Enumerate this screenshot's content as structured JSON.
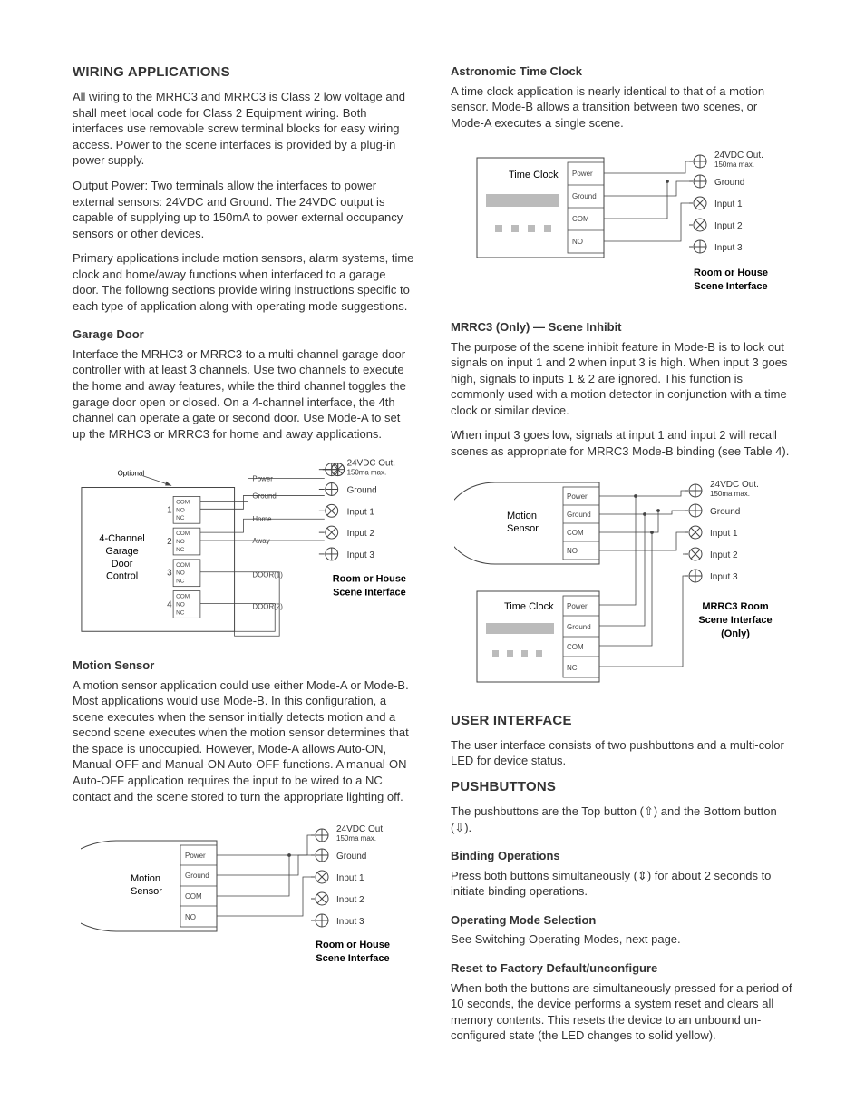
{
  "left": {
    "h_wiring": "WIRING APPLICATIONS",
    "p_wiring1": "All wiring to the MRHC3 and MRRC3 is Class 2 low voltage and shall meet local code for Class 2 Equipment wiring. Both interfaces use removable screw terminal blocks for easy wiring access. Power to the scene interfaces is provided by a plug-in power supply.",
    "p_wiring2": "Output Power: Two terminals allow the interfaces to power external sensors: 24VDC and Ground. The 24VDC output is capable of supplying up to 150mA to power external occupancy sensors or other devices.",
    "p_wiring3": "Primary applications include motion sensors, alarm systems, time clock and home/away functions when interfaced to a garage door. The followng sections provide wiring instructions specific to each type of application along with operating mode suggestions.",
    "h_garage": "Garage Door",
    "p_garage": "Interface the MRHC3 or MRRC3 to a multi-channel garage door controller with at least 3 channels. Use two channels to execute the home and away features, while the third channel toggles the garage door open or closed. On a 4-channel interface, the 4th channel can operate a gate or second door. Use Mode-A to set up the MRHC3 or MRRC3 for home and away applications.",
    "h_motion": "Motion Sensor",
    "p_motion": "A motion sensor application could use either Mode-A or Mode-B. Most applications would use Mode-B. In this configuration, a scene executes when the sensor initially detects motion and a second scene executes when the motion sensor determines that the space is unoccupied. However, Mode-A allows Auto-ON, Manual-OFF and Manual-ON Auto-OFF functions. A manual-ON Auto-OFF application requires the input to be wired to a NC contact and the scene stored to turn the appropriate lighting off."
  },
  "right": {
    "h_astro": "Astronomic Time Clock",
    "p_astro": "A time clock application is nearly identical to that of a motion sensor. Mode-B allows a transition between two scenes, or Mode-A executes a single scene.",
    "h_inhibit": "MRRC3 (Only) — Scene Inhibit",
    "p_inhibit1": "The purpose of the scene inhibit feature in Mode-B is to lock out signals on input 1 and 2 when input 3 is high. When input 3 goes high, signals to inputs 1 & 2 are ignored. This function is commonly used with a motion detector in conjunction with a time clock or similar device.",
    "p_inhibit2": "When input 3 goes low, signals at input 1 and input 2 will recall scenes as appropriate for MRRC3 Mode-B binding (see Table 4).",
    "h_ui": "USER INTERFACE",
    "p_ui": "The user interface consists of two pushbuttons and a multi-color LED for device status.",
    "h_push": "PUSHBUTTONS",
    "p_push": "The pushbuttons are the Top button (⇧) and the Bottom button (⇩).",
    "h_bind": "Binding Operations",
    "p_bind": "Press both buttons simultaneously (⇕) for about 2 seconds to initiate binding operations.",
    "h_mode": "Operating Mode Selection",
    "p_mode": "See Switching Operating Modes, next page.",
    "h_reset": "Reset to Factory Default/unconfigure",
    "p_reset": "When both the buttons are simultaneously pressed for a period of 10 seconds, the device performs a system reset and clears all memory contents. This resets the device to an unbound un-configured state (the LED changes to solid yellow)."
  },
  "labels": {
    "vdc": "24VDC Out.",
    "ma": "150ma max.",
    "ground": "Ground",
    "in1": "Input 1",
    "in2": "Input 2",
    "in3": "Input 3",
    "power": "Power",
    "com": "COM",
    "no": "NO",
    "nc": "NC",
    "home": "Home",
    "away": "Away",
    "door1": "DOOR(1)",
    "door2": "DOOR(2)",
    "optional": "Optional",
    "motion": "Motion",
    "sensor": "Sensor",
    "timeclock": "Time Clock",
    "four_ch_1": "4-Channel",
    "four_ch_2": "Garage",
    "four_ch_3": "Door",
    "four_ch_4": "Control",
    "rh1": "Room or House",
    "rh2": "Scene Interface",
    "mrrc1": "MRRC3 Room",
    "mrrc2": "Scene Interface",
    "mrrc3": "(Only)"
  }
}
